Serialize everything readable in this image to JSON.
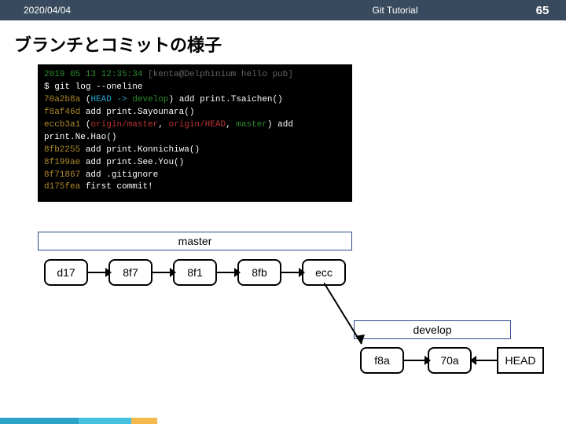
{
  "header": {
    "date": "2020/04/04",
    "title": "Git Tutorial",
    "page": "65"
  },
  "slide_title": "ブランチとコミットの様子",
  "terminal": {
    "timestamp": "2019 05 13 12:35:34",
    "userhost": "[kenta@Delphinium hello pub]",
    "prompt": "$",
    "command": "git log --oneline",
    "lines": [
      {
        "hash": "70a2b8a",
        "refs": "(HEAD -> develop)",
        "msg": "add print.Tsaichen()"
      },
      {
        "hash": "f8af46d",
        "refs": "",
        "msg": "add print.Sayounara()"
      },
      {
        "hash": "eccb3a1",
        "refs": "(origin/master, origin/HEAD, master)",
        "msg": "add print.Ne.Hao()"
      },
      {
        "hash": "8fb2255",
        "refs": "",
        "msg": "add print.Konnichiwa()"
      },
      {
        "hash": "8f199ae",
        "refs": "",
        "msg": "add print.See.You()"
      },
      {
        "hash": "8f71867",
        "refs": "",
        "msg": "add .gitignore"
      },
      {
        "hash": "d175fea",
        "refs": "",
        "msg": "first commit!"
      }
    ]
  },
  "branches": {
    "master": "master",
    "develop": "develop",
    "head": "HEAD"
  },
  "commits": {
    "c1": "d17",
    "c2": "8f7",
    "c3": "8f1",
    "c4": "8fb",
    "c5": "ecc",
    "c6": "f8a",
    "c7": "70a"
  }
}
